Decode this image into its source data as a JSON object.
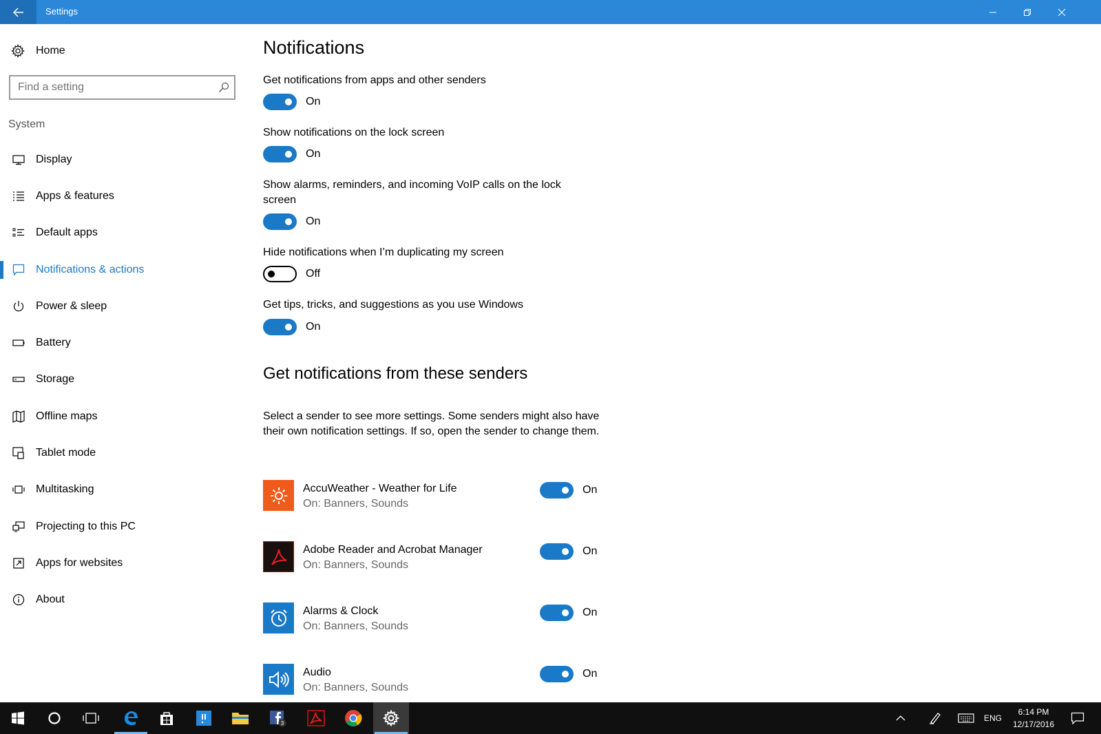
{
  "window": {
    "title": "Settings",
    "accent": "#2b88d8"
  },
  "sidebar": {
    "home_label": "Home",
    "search_placeholder": "Find a setting",
    "section_label": "System",
    "items": [
      {
        "label": "Display",
        "icon": "display-icon",
        "active": false
      },
      {
        "label": "Apps & features",
        "icon": "apps-features-icon",
        "active": false
      },
      {
        "label": "Default apps",
        "icon": "default-apps-icon",
        "active": false
      },
      {
        "label": "Notifications & actions",
        "icon": "notifications-icon",
        "active": true
      },
      {
        "label": "Power & sleep",
        "icon": "power-icon",
        "active": false
      },
      {
        "label": "Battery",
        "icon": "battery-icon",
        "active": false
      },
      {
        "label": "Storage",
        "icon": "storage-icon",
        "active": false
      },
      {
        "label": "Offline maps",
        "icon": "map-icon",
        "active": false
      },
      {
        "label": "Tablet mode",
        "icon": "tablet-mode-icon",
        "active": false
      },
      {
        "label": "Multitasking",
        "icon": "multitasking-icon",
        "active": false
      },
      {
        "label": "Projecting to this PC",
        "icon": "projecting-icon",
        "active": false
      },
      {
        "label": "Apps for websites",
        "icon": "apps-websites-icon",
        "active": false
      },
      {
        "label": "About",
        "icon": "info-icon",
        "active": false
      }
    ]
  },
  "main": {
    "title": "Notifications",
    "options": [
      {
        "label": "Get notifications from apps and other senders",
        "state": "On",
        "on": true
      },
      {
        "label": "Show notifications on the lock screen",
        "state": "On",
        "on": true
      },
      {
        "label": "Show alarms, reminders, and incoming VoIP calls on the lock screen",
        "state": "On",
        "on": true
      },
      {
        "label": "Hide notifications when I’m duplicating my screen",
        "state": "Off",
        "on": false
      },
      {
        "label": "Get tips, tricks, and suggestions as you use Windows",
        "state": "On",
        "on": true
      }
    ],
    "senders_heading": "Get notifications from these senders",
    "senders_description": "Select a sender to see more settings. Some senders might also have their own notification settings. If so, open the sender to change them.",
    "senders": [
      {
        "name": "AccuWeather - Weather for Life",
        "detail": "On: Banners, Sounds",
        "state": "On",
        "icon": "accuweather-icon",
        "color": "#f05a1a"
      },
      {
        "name": "Adobe Reader and Acrobat Manager",
        "detail": "On: Banners, Sounds",
        "state": "On",
        "icon": "adobe-acrobat-icon",
        "color": "#1a0f0f"
      },
      {
        "name": "Alarms & Clock",
        "detail": "On: Banners, Sounds",
        "state": "On",
        "icon": "alarm-clock-icon",
        "color": "#1a7ac8"
      },
      {
        "name": "Audio",
        "detail": "On: Banners, Sounds",
        "state": "On",
        "icon": "speaker-icon",
        "color": "#1a7ac8"
      }
    ]
  },
  "taskbar": {
    "language": "ENG",
    "time": "6:14 PM",
    "date": "12/17/2016",
    "facebook_badge": "3"
  }
}
